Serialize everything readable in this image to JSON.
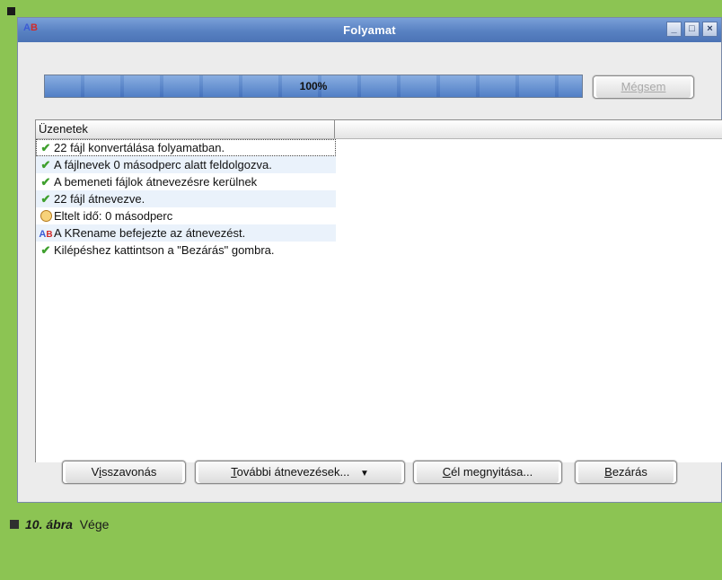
{
  "window": {
    "title": "Folyamat",
    "icon": "krename-icon",
    "controls": [
      "minimize-icon",
      "maximize-icon",
      "close-icon"
    ]
  },
  "progress": {
    "percent_label": "100%",
    "value": 1.0,
    "cancel_label": "Mégsem",
    "cancel_enabled": false
  },
  "messages": {
    "header": "Üzenetek",
    "rows": [
      {
        "icon": "check-icon",
        "text": "22 fájl konvertálása folyamatban."
      },
      {
        "icon": "check-icon",
        "text": "A fájlnevek 0 másodperc alatt feldolgozva."
      },
      {
        "icon": "check-icon",
        "text": "A bemeneti fájlok átnevezésre kerülnek"
      },
      {
        "icon": "check-icon",
        "text": "22 fájl átnevezve."
      },
      {
        "icon": "clock-icon",
        "text": "Eltelt idő: 0 másodperc"
      },
      {
        "icon": "krename-icon",
        "text": "A KRename befejezte az átnevezést."
      },
      {
        "icon": "check-icon",
        "text": "Kilépéshez kattintson a \"Bezárás\" gombra."
      }
    ]
  },
  "buttons": {
    "undo": {
      "pre": "V",
      "key": "i",
      "post": "sszavonás"
    },
    "more": {
      "pre": "",
      "key": "T",
      "post": "ovábbi átnevezések..."
    },
    "open": {
      "pre": "",
      "key": "C",
      "post": "él megnyitása..."
    },
    "close": {
      "pre": "",
      "key": "B",
      "post": "ezárás"
    }
  },
  "caption": {
    "label": "10. ábra",
    "text": "Vége"
  }
}
